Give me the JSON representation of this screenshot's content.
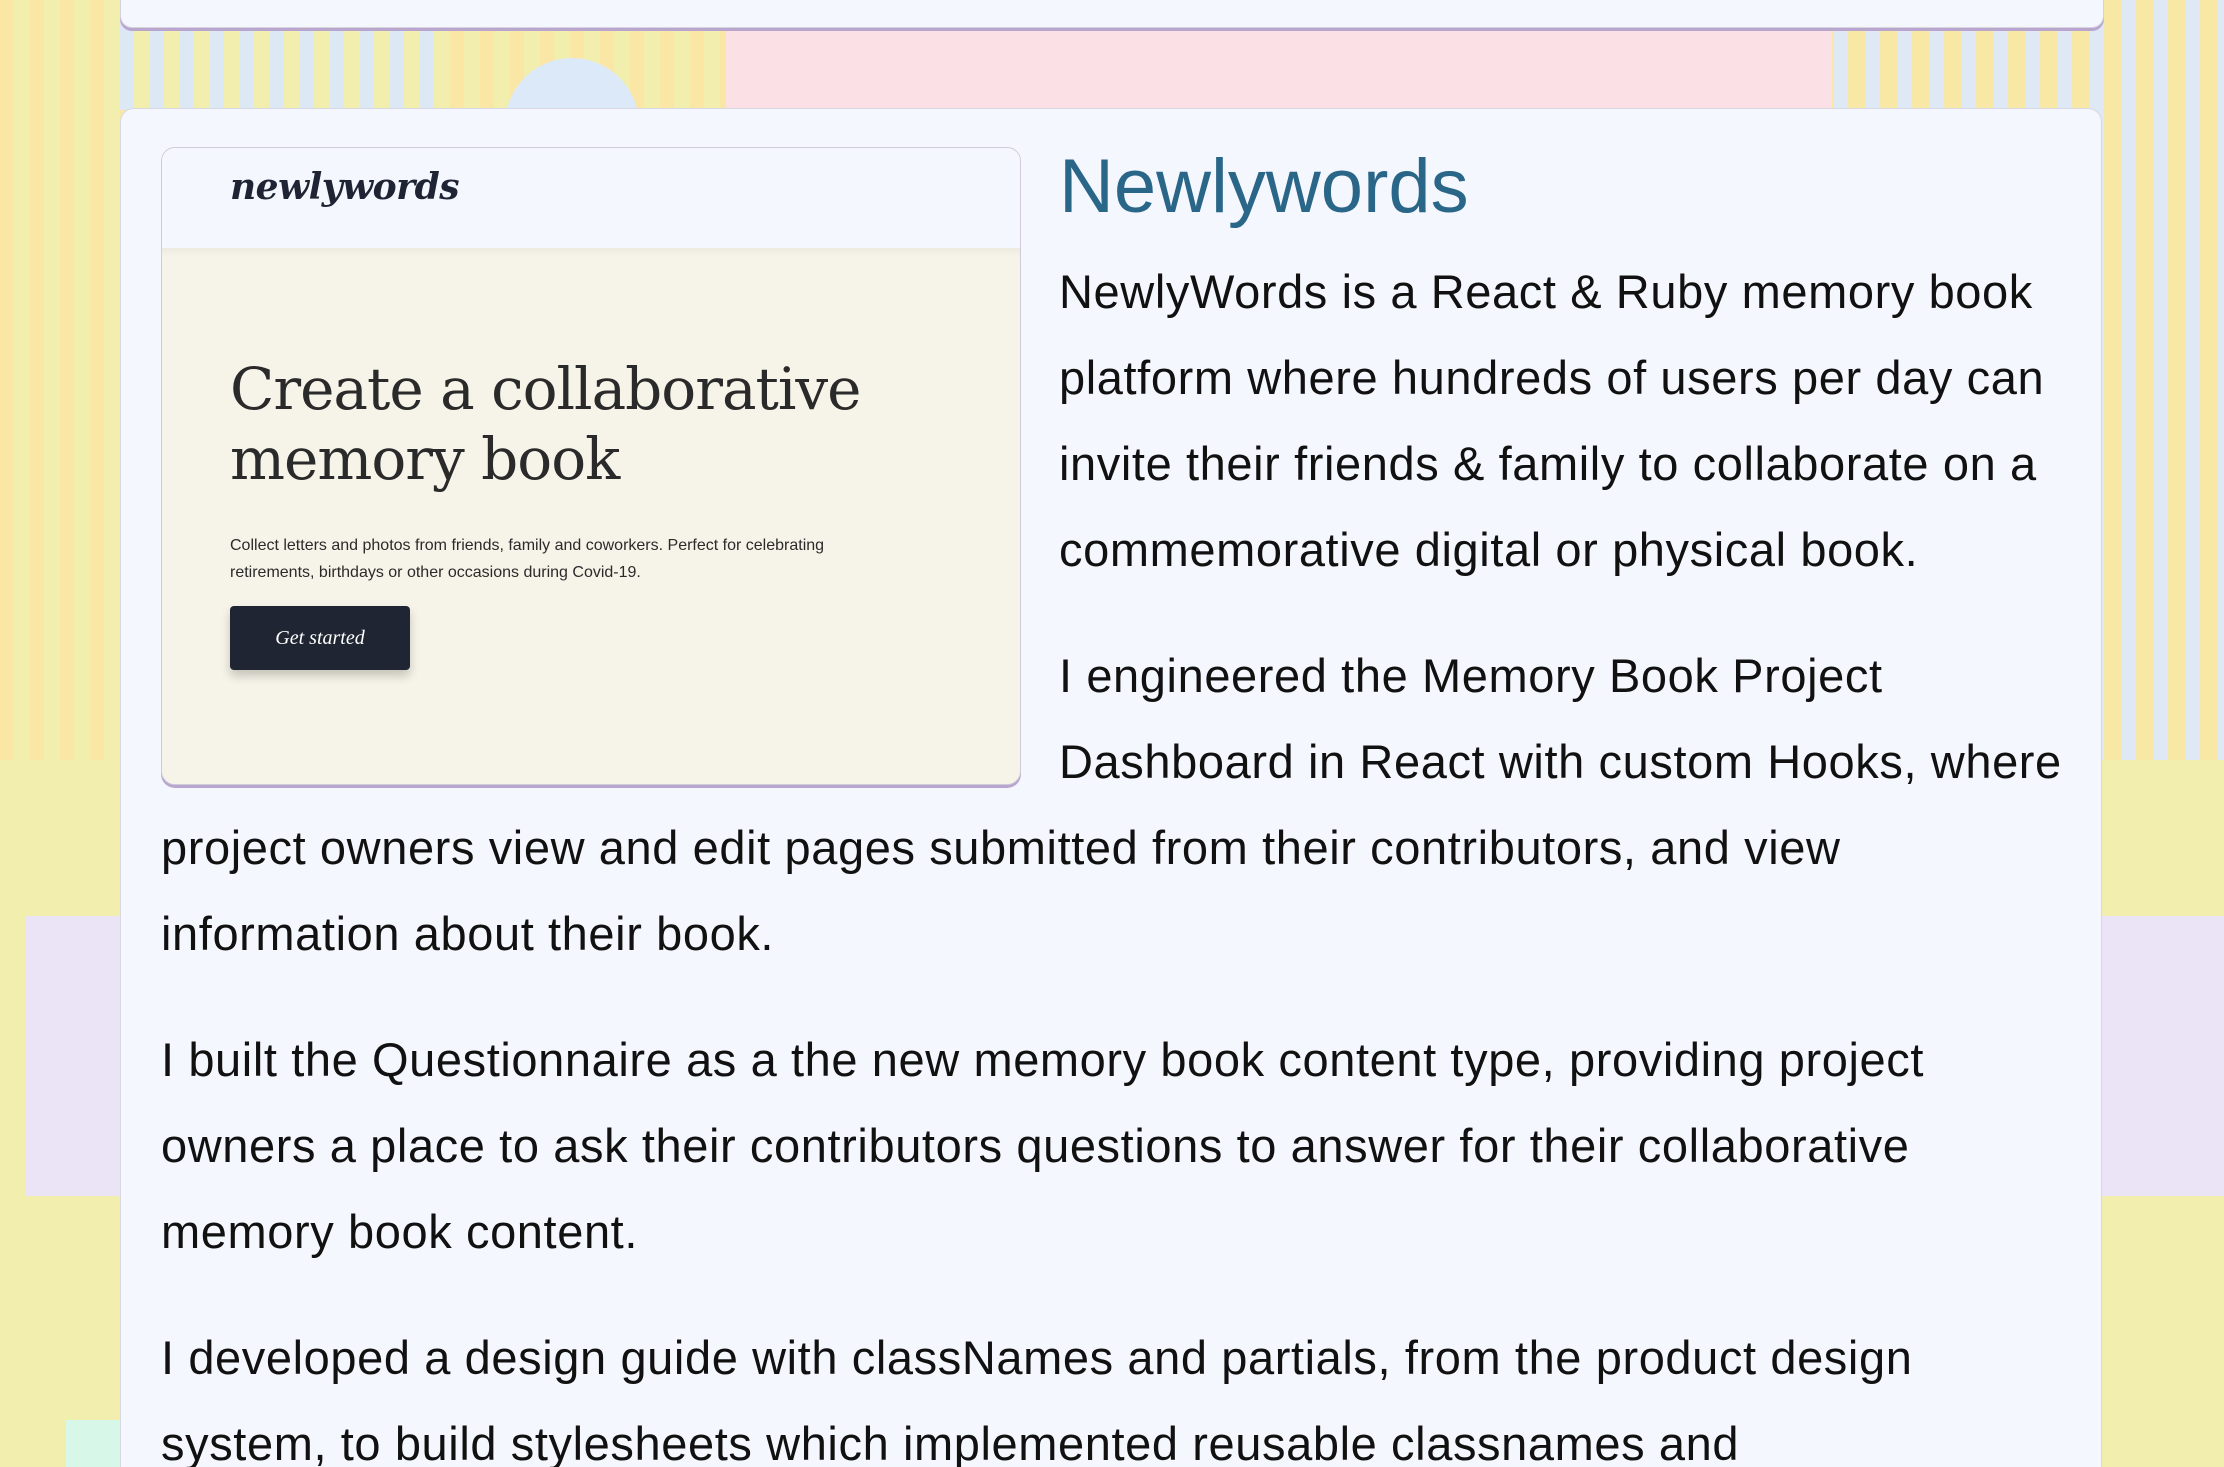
{
  "project": {
    "title": "Newlywords",
    "screenshot": {
      "logo": "newlywords",
      "headline": "Create a collaborative memory book",
      "subtext": "Collect letters and photos from friends, family and coworkers. Perfect for celebrating retirements, birthdays or other occasions during Covid-19.",
      "button_label": "Get started"
    },
    "paragraphs": [
      "NewlyWords is a React & Ruby memory book platform where hundreds of users per day can invite their friends & family to collaborate on a commemorative digital or physical book.",
      "I engineered the Memory Book Project Dashboard in React with custom Hooks, where project owners view and edit pages submitted from their contributors, and view information about their book.",
      "I built the Questionnaire as a the new memory book content type, providing project owners a place to ask their contributors questions to answer for their collaborative memory book content.",
      "I developed a design guide with classNames and partials, from the product design system, to build stylesheets which implemented reusable classnames and"
    ]
  },
  "colors": {
    "title": "#2a6688",
    "background": "#f1eeae",
    "card": "#f4f7fe",
    "button": "#1f2533"
  }
}
